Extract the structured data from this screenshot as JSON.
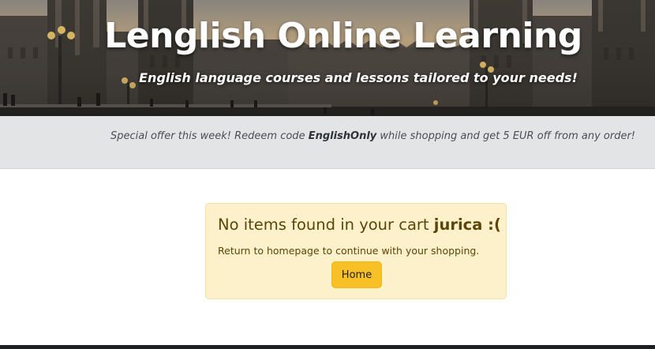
{
  "hero": {
    "title": "Lenglish Online Learning",
    "subtitle": "English language courses and lessons tailored to your needs!"
  },
  "offer": {
    "text_before": "Special offer this week! Redeem code ",
    "code": "EnglishOnly",
    "text_after": " while shopping and get 5 EUR off from any order!"
  },
  "cart": {
    "heading_prefix": "No items found in your cart ",
    "username": "jurica :(",
    "message": "Return to homepage to continue with your shopping.",
    "home_button": "Home"
  },
  "colors": {
    "offer_background": "#e3e4e6",
    "alert_background": "#fcf1cb",
    "alert_text": "#5c4508",
    "button": "#f6c026"
  }
}
